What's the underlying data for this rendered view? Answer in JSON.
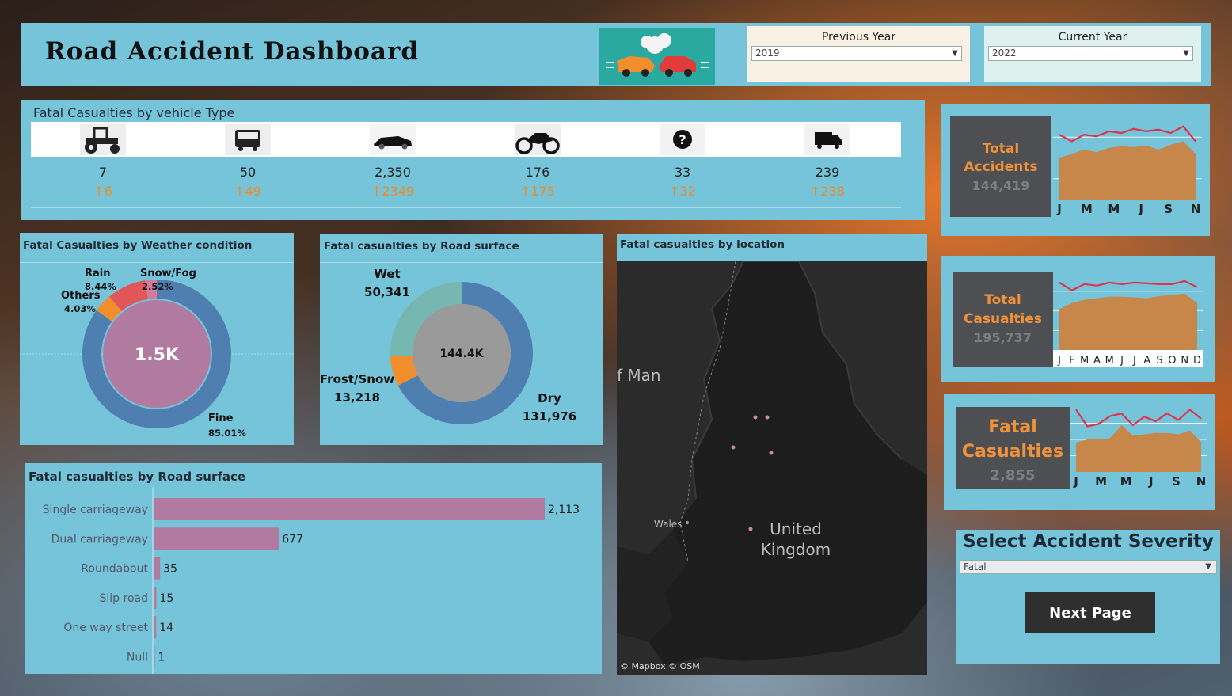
{
  "header": {
    "title": "Road Accident Dashboard",
    "previous_year_label": "Previous Year",
    "previous_year_value": "2019",
    "current_year_label": "Current Year",
    "current_year_value": "2022"
  },
  "vehicle": {
    "title": "Fatal  Casualties by vehicle Type",
    "items": [
      {
        "icon": "tractor-icon",
        "value": "7",
        "delta": "↑6"
      },
      {
        "icon": "bus-icon",
        "value": "50",
        "delta": "↑49"
      },
      {
        "icon": "car-icon",
        "value": "2,350",
        "delta": "↑2349"
      },
      {
        "icon": "motorcycle-icon",
        "value": "176",
        "delta": "↑175"
      },
      {
        "icon": "question-icon",
        "value": "33",
        "delta": "↑32"
      },
      {
        "icon": "van-icon",
        "value": "239",
        "delta": "↑238"
      }
    ]
  },
  "kpis": [
    {
      "label1": "Total",
      "label2": "Accidents",
      "value": "144,419",
      "months": [
        "J",
        "M",
        "M",
        "J",
        "S",
        "N"
      ],
      "line": [
        0.78,
        0.7,
        0.78,
        0.76,
        0.82,
        0.8,
        0.85,
        0.82,
        0.84,
        0.8,
        0.88,
        0.7
      ],
      "area": [
        0.5,
        0.55,
        0.6,
        0.57,
        0.62,
        0.64,
        0.63,
        0.65,
        0.6,
        0.66,
        0.7,
        0.55
      ]
    },
    {
      "label1": "Total",
      "label2": "Casualties",
      "value": "195,737",
      "months": [
        "J",
        "F",
        "M",
        "A",
        "M",
        "J",
        "J",
        "A",
        "S",
        "O",
        "N",
        "D"
      ],
      "line": [
        0.86,
        0.76,
        0.84,
        0.82,
        0.86,
        0.84,
        0.86,
        0.85,
        0.84,
        0.84,
        0.88,
        0.8
      ],
      "area": [
        0.52,
        0.6,
        0.64,
        0.66,
        0.68,
        0.68,
        0.67,
        0.66,
        0.69,
        0.7,
        0.72,
        0.6
      ]
    },
    {
      "label1": "Fatal",
      "label2": "Casualties",
      "value": "2,855",
      "months": [
        "J",
        "M",
        "M",
        "J",
        "S",
        "N"
      ],
      "line": [
        0.96,
        0.7,
        0.74,
        0.86,
        0.9,
        0.72,
        0.85,
        0.78,
        0.9,
        0.8,
        0.96,
        0.82
      ],
      "area": [
        0.45,
        0.5,
        0.5,
        0.52,
        0.72,
        0.56,
        0.58,
        0.6,
        0.6,
        0.58,
        0.64,
        0.46
      ]
    }
  ],
  "weather": {
    "title": "Fatal  Casualties  by Weather condition",
    "center_value": "1.5K",
    "segments": [
      {
        "label": "Fine",
        "pct": "85.01%",
        "value": 85.01,
        "color": "#4f7fb0"
      },
      {
        "label": "Others",
        "pct": "4.03%",
        "value": 4.03,
        "color": "#f28e2b"
      },
      {
        "label": "Rain",
        "pct": "8.44%",
        "value": 8.44,
        "color": "#e15759"
      },
      {
        "label": "Snow/Fog",
        "pct": "2.52%",
        "value": 2.52,
        "color": "#d47a9b"
      }
    ]
  },
  "road_surface": {
    "title": "Fatal  casualties  by Road surface",
    "center_value": "144.4K",
    "segments": [
      {
        "label": "Dry",
        "value_text": "131,976",
        "value": 131976,
        "color": "#4f7fb0"
      },
      {
        "label": "Frost/Snow",
        "value_text": "13,218",
        "value": 13218,
        "color": "#f28e2b"
      },
      {
        "label": "Wet",
        "value_text": "50,341",
        "value": 50341,
        "color": "#76b7b2"
      }
    ]
  },
  "location": {
    "title": "Fatal casualties by location",
    "label_sea": "f Man",
    "label_wales": "Wales",
    "label_country1": "United",
    "label_country2": "Kingdom",
    "attribution": "© Mapbox © OSM"
  },
  "bar_chart": {
    "title": "Fatal casualties by Road surface",
    "chart_data": {
      "type": "bar",
      "orientation": "horizontal",
      "categories": [
        "Single carriageway",
        "Dual carriageway",
        "Roundabout",
        "Slip road",
        "One way street",
        "Null"
      ],
      "values": [
        2113,
        677,
        35,
        15,
        14,
        1
      ],
      "value_labels": [
        "2,113",
        "677",
        "35",
        "15",
        "14",
        "1"
      ],
      "color": "#b07aa1"
    }
  },
  "severity": {
    "title": "Select Accident Severity",
    "value": "Fatal",
    "next_button": "Next Page"
  }
}
